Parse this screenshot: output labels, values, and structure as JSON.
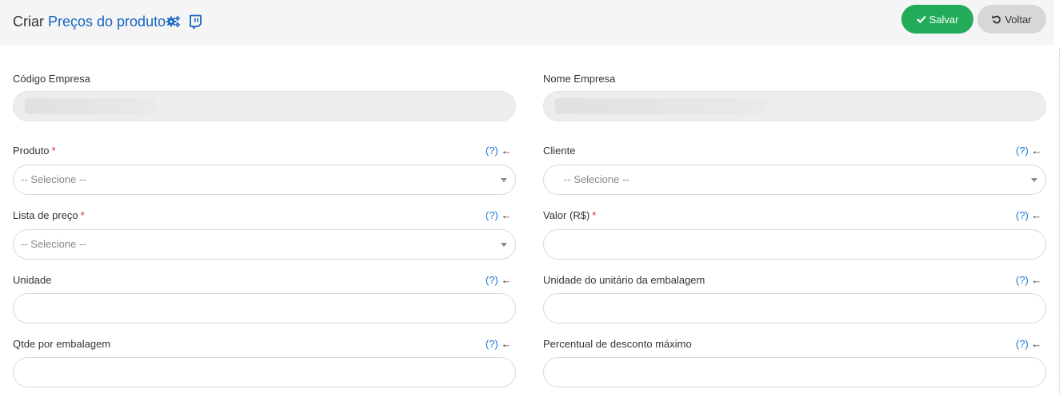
{
  "header": {
    "verb": "Criar",
    "entity": "Preços do produto",
    "save_label": "Salvar",
    "back_label": "Voltar"
  },
  "help_text": {
    "q": "(?)",
    "arrow": "←"
  },
  "required_mark": "*",
  "fields": {
    "codigo_empresa": {
      "label": "Código Empresa",
      "value": ""
    },
    "nome_empresa": {
      "label": "Nome Empresa",
      "value": ""
    },
    "produto": {
      "label": "Produto",
      "required": true,
      "placeholder": "-- Selecione --"
    },
    "cliente": {
      "label": "Cliente",
      "required": false,
      "placeholder": "-- Selecione --"
    },
    "lista_preco": {
      "label": "Lista de preço",
      "required": true,
      "placeholder": "-- Selecione --"
    },
    "valor": {
      "label": "Valor (R$)",
      "required": true,
      "value": ""
    },
    "unidade": {
      "label": "Unidade",
      "value": ""
    },
    "unidade_unitario": {
      "label": "Unidade do unitário da embalagem",
      "value": ""
    },
    "qtde_embalagem": {
      "label": "Qtde por embalagem",
      "value": ""
    },
    "percentual_desconto": {
      "label": "Percentual de desconto máximo",
      "value": ""
    }
  },
  "colors": {
    "accent": "#1565c0",
    "save": "#22ab58",
    "back": "#d7d7d7",
    "required": "#d32f2f",
    "header_bg": "#f5f5f5"
  }
}
